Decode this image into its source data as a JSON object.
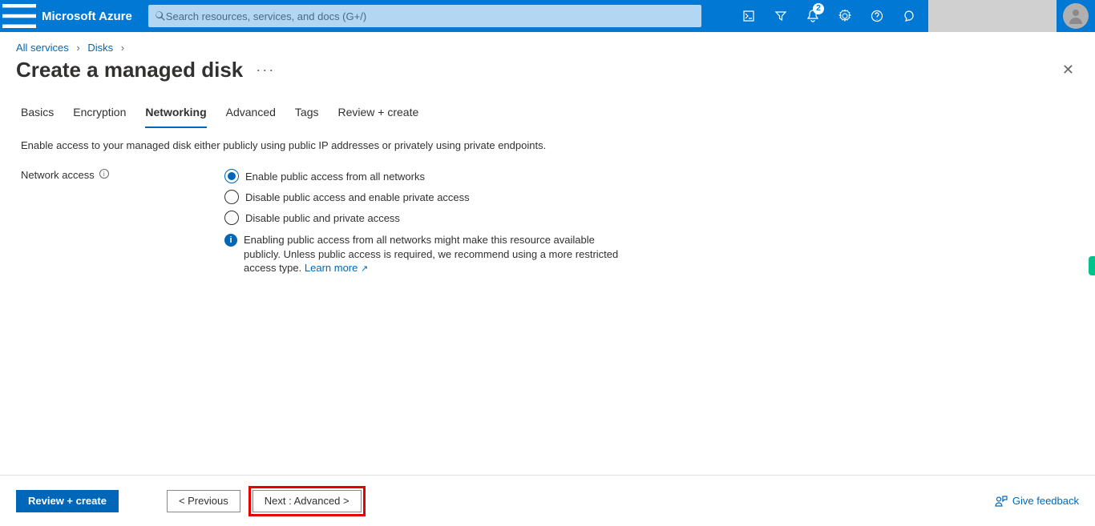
{
  "topbar": {
    "brand": "Microsoft Azure",
    "search_placeholder": "Search resources, services, and docs (G+/)",
    "notification_count": "2"
  },
  "breadcrumbs": {
    "items": [
      "All services",
      "Disks"
    ]
  },
  "page": {
    "title": "Create a managed disk",
    "more": "···"
  },
  "tabs": {
    "items": [
      {
        "label": "Basics"
      },
      {
        "label": "Encryption"
      },
      {
        "label": "Networking"
      },
      {
        "label": "Advanced"
      },
      {
        "label": "Tags"
      },
      {
        "label": "Review + create"
      }
    ],
    "active_index": 2,
    "description": "Enable access to your managed disk either publicly using public IP addresses or privately using private endpoints."
  },
  "form": {
    "network_access_label": "Network access",
    "options": [
      {
        "label": "Enable public access from all networks"
      },
      {
        "label": "Disable public access and enable private access"
      },
      {
        "label": "Disable public and private access"
      }
    ],
    "selected_index": 0,
    "info_text": "Enabling public access from all networks might make this resource available publicly. Unless public access is required, we recommend using a more restricted access type. ",
    "learn_more": "Learn more"
  },
  "footer": {
    "review": "Review + create",
    "previous": "< Previous",
    "next": "Next : Advanced >",
    "feedback": "Give feedback"
  }
}
